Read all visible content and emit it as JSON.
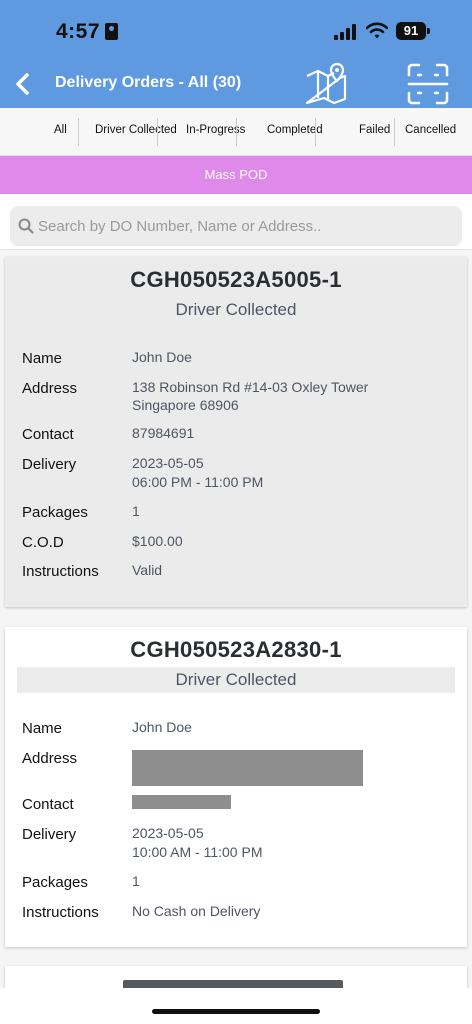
{
  "status_bar": {
    "time": "4:57",
    "battery": "91"
  },
  "nav": {
    "title": "Delivery Orders - All (30)"
  },
  "filters": [
    "All",
    "Driver Collected",
    "In-Progress",
    "Completed",
    "Failed",
    "Cancelled"
  ],
  "mass_pod": "Mass POD",
  "search": {
    "placeholder": "Search by DO Number, Name or Address.."
  },
  "labels": {
    "name": "Name",
    "address": "Address",
    "contact": "Contact",
    "delivery": "Delivery",
    "packages": "Packages",
    "cod": "C.O.D",
    "instructions": "Instructions"
  },
  "orders": [
    {
      "do_number": "CGH050523A5005-1",
      "status": "Driver Collected",
      "name": "John Doe",
      "address_line1": "138 Robinson Rd #14-03 Oxley Tower",
      "address_line2": "Singapore 68906",
      "contact": "87984691",
      "delivery_date": "2023-05-05",
      "delivery_window": "06:00 PM - 11:00 PM",
      "packages": "1",
      "cod": "$100.00",
      "instructions": "Valid"
    },
    {
      "do_number": "CGH050523A2830-1",
      "status": "Driver Collected",
      "name": "John Doe",
      "delivery_date": "2023-05-05",
      "delivery_window": "10:00 AM - 11:00 PM",
      "packages": "1",
      "instructions": "No Cash on Delivery"
    }
  ],
  "colors": {
    "header": "#5f9ae0",
    "mass_pod": "#df8aea"
  }
}
